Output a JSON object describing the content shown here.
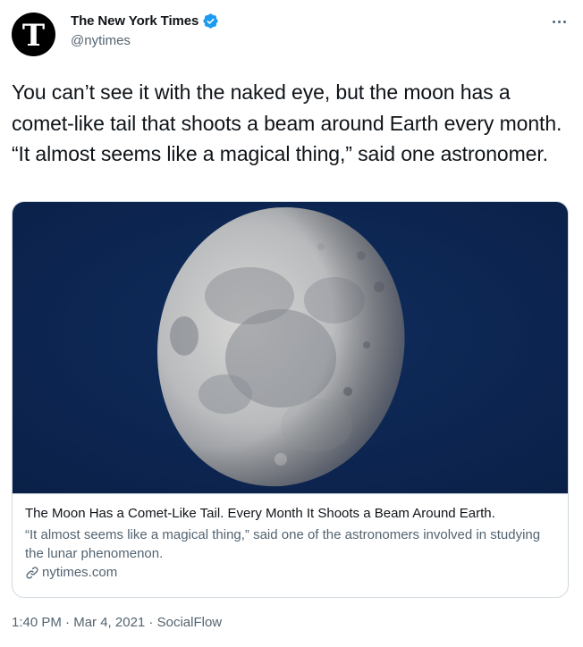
{
  "author": {
    "display_name": "The New York Times",
    "handle": "@nytimes",
    "avatar_glyph": "T",
    "verified_color": "#1d9bf0"
  },
  "tweet": {
    "text": "You can’t see it with the naked eye, but the moon has a comet-like tail that shoots a beam around Earth every month. “It almost seems like a magical thing,” said one astronomer."
  },
  "card": {
    "image_description_icon": "moon-photo",
    "title": "The Moon Has a Comet-Like Tail. Every Month It Shoots a Beam Around Earth.",
    "description": "“It almost seems like a magical thing,” said one of the astronomers involved in studying the lunar phenomenon.",
    "domain": "nytimes.com"
  },
  "meta": {
    "time": "1:40 PM",
    "date": "Mar 4, 2021",
    "source": "SocialFlow",
    "separator": " · "
  },
  "colors": {
    "text_primary": "#0f1419",
    "text_secondary": "#536471",
    "border": "#cfd9de",
    "night_sky": "#0d2650"
  }
}
